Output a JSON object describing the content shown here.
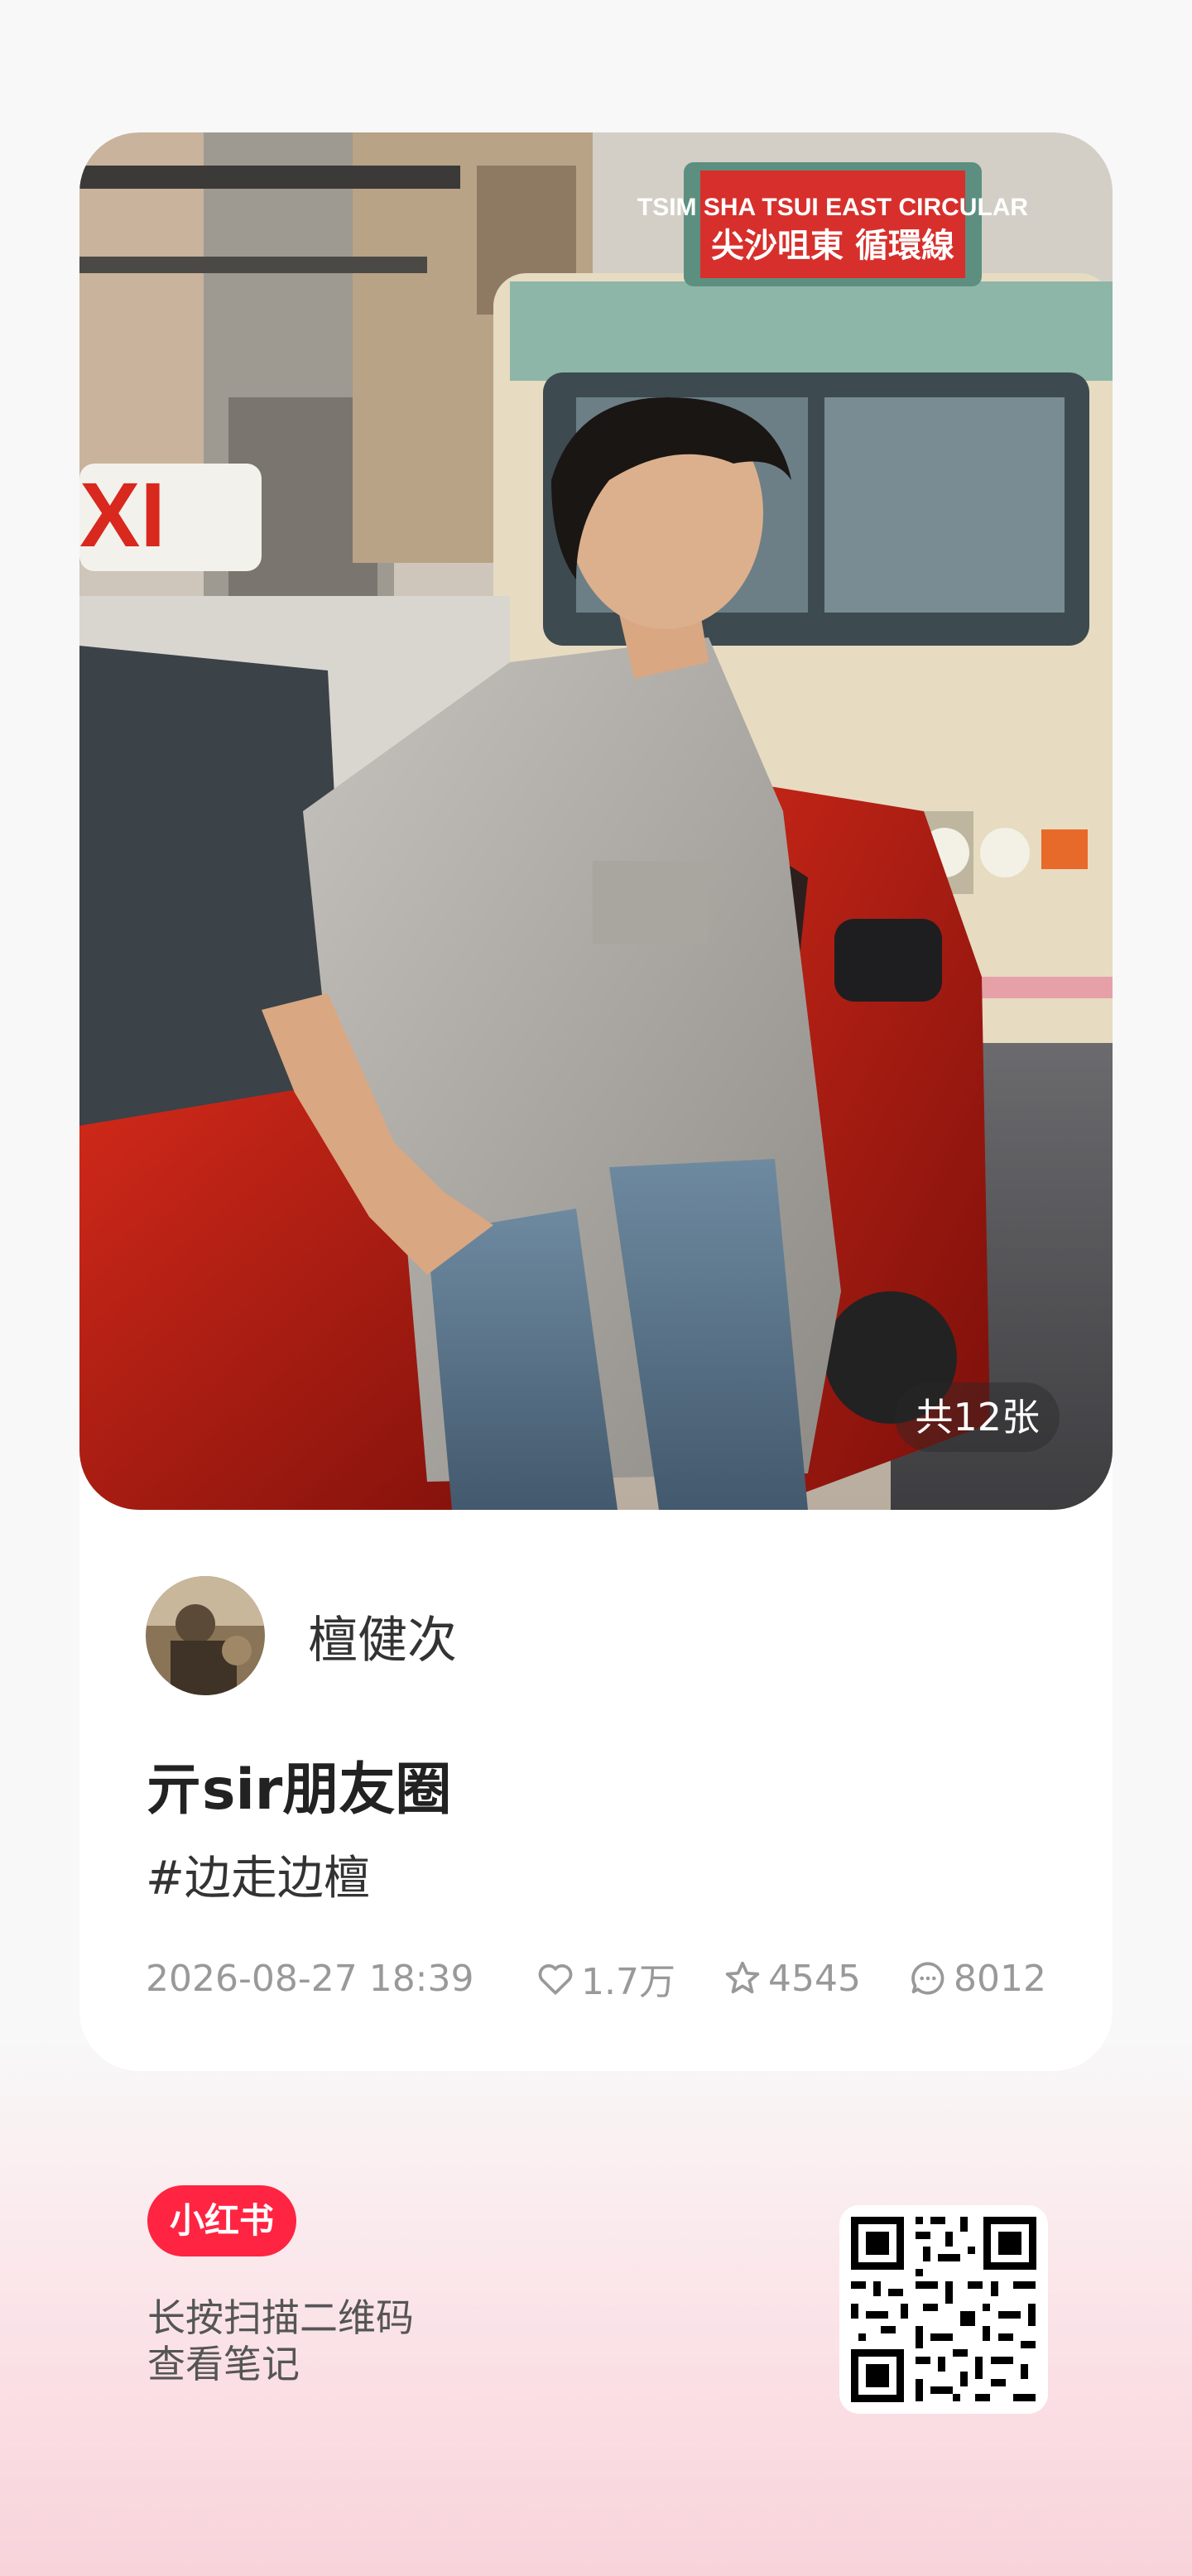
{
  "note": {
    "photo_count_label": "共12张",
    "author": {
      "name": "檀健次"
    },
    "title": "亓sir朋友圈",
    "tag": "#边走边檀",
    "date": "2026-08-27 18:39",
    "likes": "1.7万",
    "collects": "4545",
    "comments": "8012"
  },
  "photo_signs": {
    "bus_sign_line1": "TSIM SHA TSUI EAST CIRCULAR",
    "bus_sign_line2": "尖沙咀東 循環線",
    "taxi_sign": "XI"
  },
  "footer": {
    "logo_text": "小红书",
    "hint_line1": "长按扫描二维码",
    "hint_line2": "查看笔记"
  },
  "icons": {
    "likes": "heart-icon",
    "collects": "star-icon",
    "comments": "comment-icon"
  },
  "colors": {
    "brand": "#ff2442",
    "meta_text": "#999999",
    "title_text": "#222222"
  }
}
